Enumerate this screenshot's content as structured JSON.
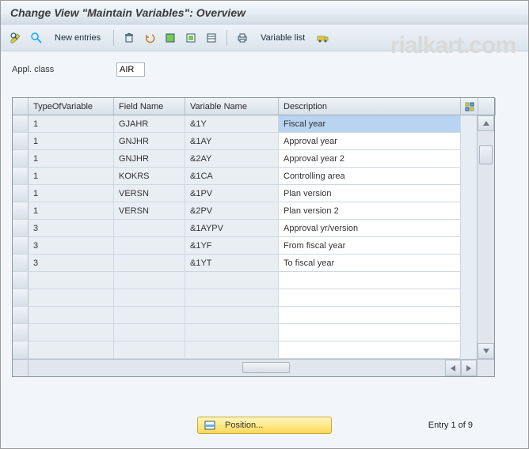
{
  "title": "Change View \"Maintain Variables\": Overview",
  "toolbar": {
    "new_entries": "New entries",
    "var_list": "Variable list"
  },
  "field": {
    "appl_class_label": "Appl. class",
    "appl_class_value": "AIR"
  },
  "columns": {
    "type": "TypeOfVariable",
    "field": "Field Name",
    "var": "Variable Name",
    "desc": "Description"
  },
  "rows": [
    {
      "type": "1",
      "field": "GJAHR",
      "var": "&1Y",
      "desc": "Fiscal year",
      "selected": true
    },
    {
      "type": "1",
      "field": "GNJHR",
      "var": "&1AY",
      "desc": "Approval year",
      "selected": false
    },
    {
      "type": "1",
      "field": "GNJHR",
      "var": "&2AY",
      "desc": "Approval year 2",
      "selected": false
    },
    {
      "type": "1",
      "field": "KOKRS",
      "var": "&1CA",
      "desc": "Controlling area",
      "selected": false
    },
    {
      "type": "1",
      "field": "VERSN",
      "var": "&1PV",
      "desc": "Plan version",
      "selected": false
    },
    {
      "type": "1",
      "field": "VERSN",
      "var": "&2PV",
      "desc": "Plan version 2",
      "selected": false
    },
    {
      "type": "3",
      "field": "",
      "var": "&1AYPV",
      "desc": "Approval yr/version",
      "selected": false
    },
    {
      "type": "3",
      "field": "",
      "var": "&1YF",
      "desc": "From fiscal year",
      "selected": false
    },
    {
      "type": "3",
      "field": "",
      "var": "&1YT",
      "desc": "To fiscal year",
      "selected": false
    }
  ],
  "blank_rows": 5,
  "footer": {
    "position_label": "Position...",
    "entry_text": "Entry 1 of 9"
  },
  "watermark": "rialkart.com"
}
